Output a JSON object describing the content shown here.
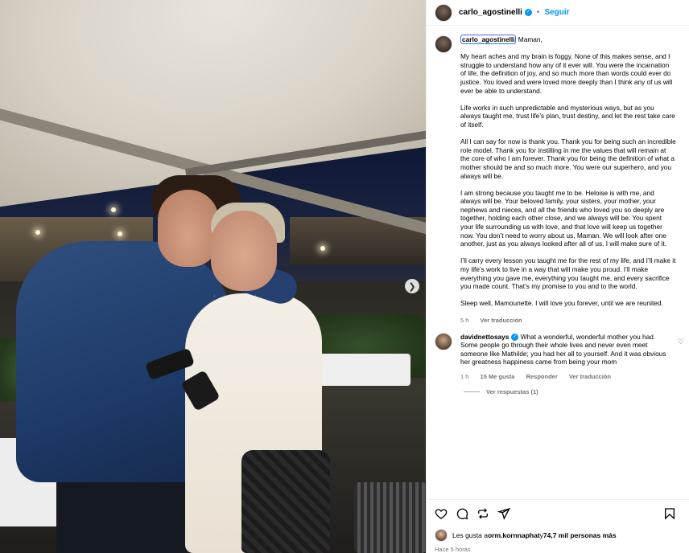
{
  "header": {
    "username": "carlo_agostinelli",
    "follow_label": "Seguir"
  },
  "caption": {
    "username": "carlo_agostinelli",
    "opening": "Maman,",
    "paragraphs": [
      "My heart aches and my brain is foggy. None of this makes sense, and I struggle to understand how any of it ever will. You were the incarnation of life, the definition of joy, and so much more than words could ever do justice. You loved and were loved more deeply than I think any of us will ever be able to understand.",
      "Life works in such unpredictable and mysterious ways, but as you always taught me, trust life’s plan, trust destiny, and let the rest take care of itself.",
      "All I can say for now is thank you. Thank you for being such an incredible role model. Thank you for instilling in me the values that will remain at the core of who I am forever. Thank you for being the definition of what a mother should be and so much more. You were our superhero, and you always will be.",
      "I am strong because you taught me to be. Heloise is with me, and always will be. Your beloved family, your sisters, your mother, your nephews and nieces, and all the friends who loved you so deeply are together, holding each other close, and we always will be. You spent your life surrounding us with love, and that love will keep us together now. You don’t need to worry about us, Maman. We will look after one another, just as you always looked after all of us. I will make sure of it.",
      "I’ll carry every lesson you taught me for the rest of my life, and I’ll make it my life’s work to live in a way that will make you proud. I’ll make everything you gave me, everything you taught me, and every sacrifice you made count. That’s my promise to you and to the world.",
      "Sleep well, Mamounette. I will love you forever, until we are reunited."
    ],
    "time": "5 h",
    "see_translation": "Ver traducción"
  },
  "comment": {
    "username": "davidnettosays",
    "text": "What a wonderful, wonderful mother you had. Some people go through their whole lives and never even meet someone like Mathilde; you had her all to yourself. And it was obvious her greatness happiness came from being your mom",
    "time": "1 h",
    "likes": "15 Me gusta",
    "reply": "Responder",
    "see_translation": "Ver traducción",
    "view_replies": "Ver respuestas (1)"
  },
  "actions": {
    "like_icon": "heart-icon",
    "comment_icon": "comment-icon",
    "share_icon": "repost-icon",
    "send_icon": "send-icon",
    "save_icon": "bookmark-icon"
  },
  "likes": {
    "prefix": "Les gusta a ",
    "user": "orm.kornnaphat",
    "middle": " y ",
    "count": "74,7 mil personas más"
  },
  "posted_ago": "Hace 5 horas",
  "colors": {
    "link_blue": "#0095f6",
    "muted": "#737373"
  }
}
